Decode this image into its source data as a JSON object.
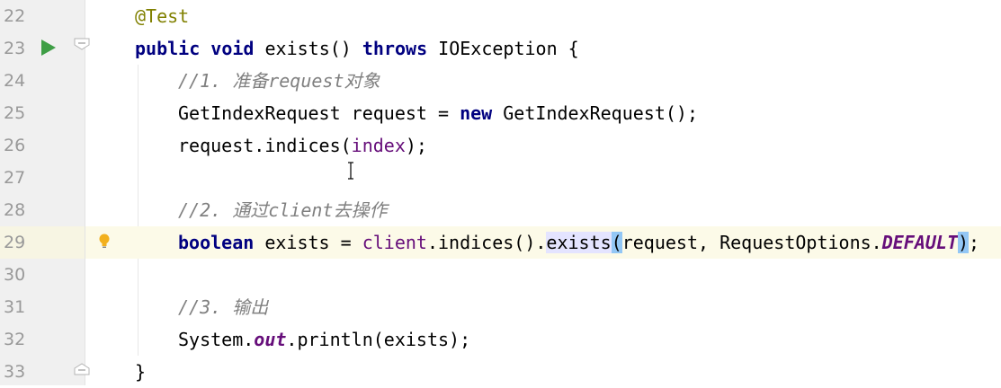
{
  "editor": {
    "lines": [
      {
        "num": "22"
      },
      {
        "num": "23"
      },
      {
        "num": "24"
      },
      {
        "num": "25"
      },
      {
        "num": "26"
      },
      {
        "num": "27"
      },
      {
        "num": "28"
      },
      {
        "num": "29"
      },
      {
        "num": "30"
      },
      {
        "num": "31"
      },
      {
        "num": "32"
      },
      {
        "num": "33"
      }
    ],
    "tokens": {
      "l22_ann": "@Test",
      "l23_kw1": "public",
      "l23_kw2": "void",
      "l23_name": " exists() ",
      "l23_kw3": "throws",
      "l23_rest": " IOException {",
      "l24_cmt": "//1. 准备request对象",
      "l25_a": "GetIndexRequest request = ",
      "l25_kw": "new",
      "l25_b": " GetIndexRequest();",
      "l26_a": "request.indices(",
      "l26_fld": "index",
      "l26_b": ");",
      "l28_cmt": "//2. 通过client去操作",
      "l29_kw": "boolean",
      "l29_a": " exists = ",
      "l29_fld": "client",
      "l29_b": ".indices().",
      "l29_hl": "exists",
      "l29_p1": "(",
      "l29_c": "request, RequestOptions.",
      "l29_static": "DEFAULT",
      "l29_p2": ")",
      "l29_end": ";",
      "l31_cmt": "//3. 输出",
      "l32_a": "System.",
      "l32_out": "out",
      "l32_b": ".println(exists);",
      "l33_brace": "}"
    },
    "icons": {
      "run": "run-gutter-icon",
      "fold": "fold-marker-icon",
      "bulb": "lightbulb-intention-icon",
      "cursor": "text-cursor-icon"
    },
    "colors": {
      "keyword": "#000080",
      "annotation": "#808000",
      "comment": "#808080",
      "field": "#660e7a",
      "current_line": "#fcfae8",
      "run_icon": "#3e9e45",
      "bulb": "#f2b01e"
    }
  }
}
